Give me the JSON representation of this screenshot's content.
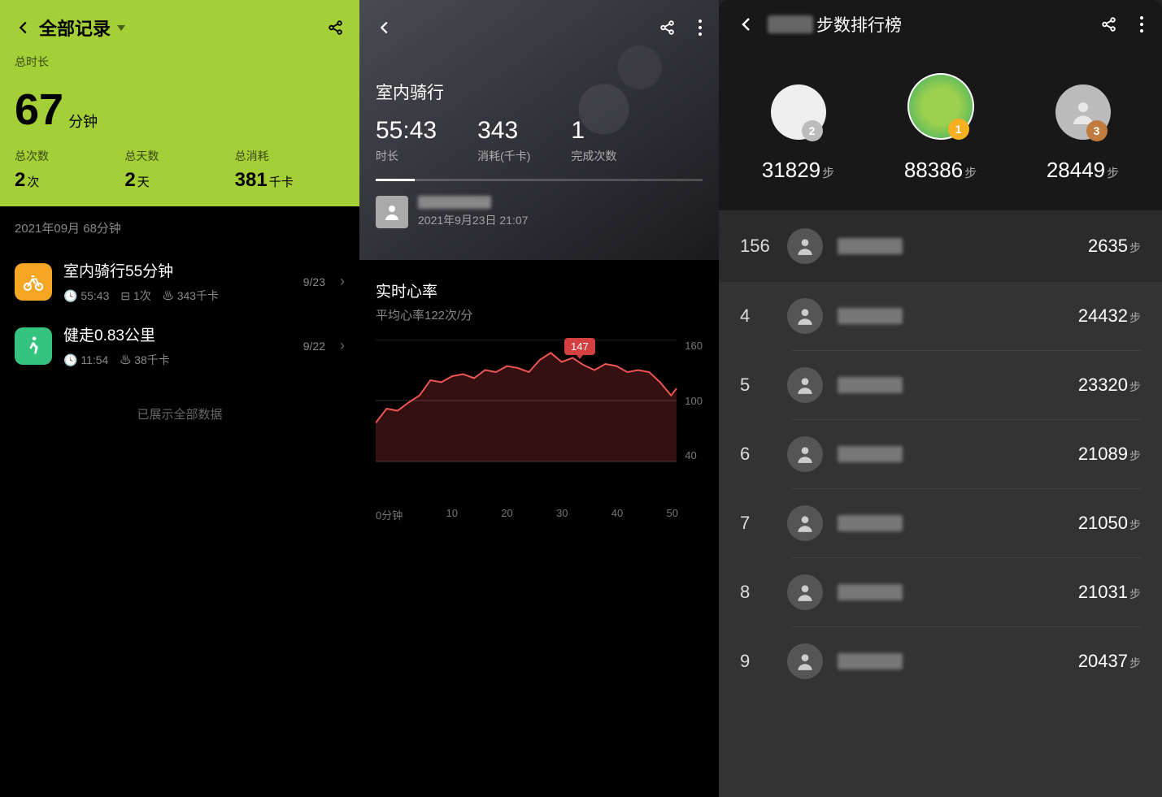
{
  "screen1": {
    "title": "全部记录",
    "total_time_label": "总时长",
    "total_time_value": "67",
    "total_time_unit": "分钟",
    "stats": [
      {
        "label": "总次数",
        "value": "2",
        "unit": "次"
      },
      {
        "label": "总天数",
        "value": "2",
        "unit": "天"
      },
      {
        "label": "总消耗",
        "value": "381",
        "unit": "千卡"
      }
    ],
    "section_header": "2021年09月 68分钟",
    "items": [
      {
        "title": "室内骑行55分钟",
        "duration": "55:43",
        "count": "1次",
        "cal": "343千卡",
        "date": "9/23"
      },
      {
        "title": "健走0.83公里",
        "duration": "11:54",
        "count": "",
        "cal": "38千卡",
        "date": "9/22"
      }
    ],
    "footer": "已展示全部数据"
  },
  "screen2": {
    "title": "室内骑行",
    "stats": [
      {
        "value": "55:43",
        "label": "时长"
      },
      {
        "value": "343",
        "label": "消耗(千卡)"
      },
      {
        "value": "1",
        "label": "完成次数"
      }
    ],
    "timestamp": "2021年9月23日 21:07",
    "chart_title": "实时心率",
    "chart_subtitle": "平均心率122次/分",
    "peak_value": "147"
  },
  "screen3": {
    "title_suffix": "步数排行榜",
    "podium": [
      {
        "rank": "2",
        "steps": "31829",
        "unit": "步"
      },
      {
        "rank": "1",
        "steps": "88386",
        "unit": "步"
      },
      {
        "rank": "3",
        "steps": "28449",
        "unit": "步"
      }
    ],
    "me": {
      "rank": "156",
      "steps": "2635",
      "unit": "步"
    },
    "list": [
      {
        "rank": "4",
        "steps": "24432",
        "unit": "步"
      },
      {
        "rank": "5",
        "steps": "23320",
        "unit": "步"
      },
      {
        "rank": "6",
        "steps": "21089",
        "unit": "步"
      },
      {
        "rank": "7",
        "steps": "21050",
        "unit": "步"
      },
      {
        "rank": "8",
        "steps": "21031",
        "unit": "步"
      },
      {
        "rank": "9",
        "steps": "20437",
        "unit": "步"
      }
    ]
  },
  "chart_data": {
    "type": "line",
    "title": "实时心率",
    "xlabel": "分钟",
    "ylabel": "次/分",
    "ylim": [
      40,
      160
    ],
    "x_ticks": [
      "0分钟",
      "10",
      "20",
      "30",
      "40",
      "50"
    ],
    "y_ticks": [
      160,
      100,
      40
    ],
    "peak": {
      "x": 32,
      "y": 147
    },
    "series": [
      {
        "name": "心率",
        "x": [
          0,
          2,
          4,
          6,
          8,
          10,
          12,
          14,
          16,
          18,
          20,
          22,
          24,
          26,
          28,
          30,
          32,
          34,
          36,
          38,
          40,
          42,
          44,
          46,
          48,
          50,
          52,
          54,
          55
        ],
        "values": [
          78,
          92,
          90,
          98,
          105,
          120,
          118,
          124,
          126,
          122,
          130,
          128,
          134,
          132,
          128,
          140,
          147,
          138,
          142,
          135,
          130,
          136,
          134,
          128,
          130,
          128,
          118,
          105,
          112
        ]
      }
    ]
  }
}
